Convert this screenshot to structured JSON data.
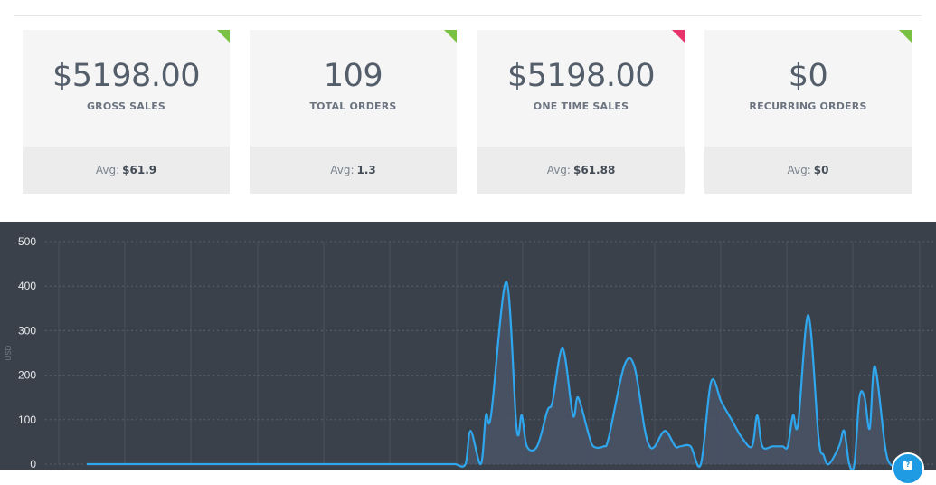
{
  "cards": [
    {
      "value": "$5198.00",
      "label": "GROSS SALES",
      "avg_label": "Avg:",
      "avg_value": "$61.9",
      "corner_color": "#7ac142"
    },
    {
      "value": "109",
      "label": "TOTAL ORDERS",
      "avg_label": "Avg:",
      "avg_value": "1.3",
      "corner_color": "#7ac142"
    },
    {
      "value": "$5198.00",
      "label": "ONE TIME SALES",
      "avg_label": "Avg:",
      "avg_value": "$61.88",
      "corner_color": "#e8336b"
    },
    {
      "value": "$0",
      "label": "RECURRING ORDERS",
      "avg_label": "Avg:",
      "avg_value": "$0",
      "corner_color": "#7ac142"
    }
  ],
  "chart_data": {
    "type": "area",
    "ylabel": "USD",
    "ylim": [
      0,
      500
    ],
    "yticks": [
      "500",
      "400",
      "300",
      "200",
      "100",
      "0"
    ],
    "grid": true,
    "line_color": "#2fa7ee",
    "fill_color": "#4a5566",
    "series": [
      {
        "values": [
          [
            0,
            0
          ],
          [
            1,
            0
          ],
          [
            2,
            0
          ],
          [
            3,
            0
          ],
          [
            4,
            0
          ],
          [
            5,
            0
          ],
          [
            6,
            0
          ],
          [
            7,
            0
          ],
          [
            8,
            0
          ],
          [
            9,
            0
          ],
          [
            10,
            0
          ],
          [
            11,
            0
          ],
          [
            12,
            0
          ],
          [
            13,
            0
          ],
          [
            14,
            0
          ],
          [
            15,
            0
          ],
          [
            16,
            0
          ],
          [
            17,
            0
          ],
          [
            18,
            0
          ],
          [
            19,
            0
          ],
          [
            20,
            0
          ],
          [
            21,
            0
          ],
          [
            22,
            0
          ],
          [
            23,
            0
          ],
          [
            24,
            0
          ],
          [
            25,
            0
          ],
          [
            26,
            0
          ],
          [
            27,
            0
          ],
          [
            28,
            0
          ],
          [
            29,
            0
          ],
          [
            30,
            0
          ],
          [
            31,
            0
          ],
          [
            32,
            0
          ],
          [
            33,
            0
          ],
          [
            34,
            0
          ],
          [
            35,
            0
          ],
          [
            36,
            0
          ],
          [
            37,
            0
          ],
          [
            38,
            0
          ],
          [
            39,
            0
          ],
          [
            40,
            0
          ],
          [
            41,
            0
          ],
          [
            42,
            0
          ],
          [
            43,
            0
          ],
          [
            44,
            0
          ],
          [
            45,
            0
          ],
          [
            46,
            0
          ],
          [
            47,
            0
          ],
          [
            48,
            0
          ],
          [
            49,
            0
          ],
          [
            50,
            0
          ],
          [
            51,
            0
          ],
          [
            52,
            0
          ],
          [
            53,
            0
          ],
          [
            54,
            0
          ],
          [
            55,
            0
          ],
          [
            56,
            0
          ],
          [
            57,
            0
          ],
          [
            58,
            0
          ],
          [
            59,
            0
          ],
          [
            60,
            0
          ],
          [
            61,
            0
          ],
          [
            62,
            0
          ],
          [
            63,
            0
          ],
          [
            64,
            0
          ],
          [
            65,
            0
          ],
          [
            66,
            0
          ],
          [
            67,
            0
          ],
          [
            68,
            0
          ],
          [
            69,
            0
          ],
          [
            70,
            0
          ],
          [
            71,
            0
          ],
          [
            72,
            0
          ],
          [
            74,
            0
          ],
          [
            75,
            75
          ],
          [
            77,
            0
          ],
          [
            78,
            110
          ],
          [
            79,
            110
          ],
          [
            82,
            410
          ],
          [
            84,
            80
          ],
          [
            85,
            110
          ],
          [
            86,
            40
          ],
          [
            88,
            40
          ],
          [
            90,
            120
          ],
          [
            91,
            140
          ],
          [
            93,
            260
          ],
          [
            95,
            110
          ],
          [
            96,
            150
          ],
          [
            98,
            70
          ],
          [
            99,
            40
          ],
          [
            101,
            40
          ],
          [
            102,
            60
          ],
          [
            105,
            220
          ],
          [
            107,
            220
          ],
          [
            109,
            80
          ],
          [
            110,
            40
          ],
          [
            111,
            40
          ],
          [
            113,
            75
          ],
          [
            115,
            40
          ],
          [
            116,
            40
          ],
          [
            118,
            40
          ],
          [
            120,
            0
          ],
          [
            122,
            185
          ],
          [
            124,
            140
          ],
          [
            126,
            100
          ],
          [
            128,
            60
          ],
          [
            130,
            40
          ],
          [
            131,
            110
          ],
          [
            132,
            40
          ],
          [
            134,
            40
          ],
          [
            135,
            40
          ],
          [
            136,
            40
          ],
          [
            137,
            40
          ],
          [
            138,
            110
          ],
          [
            139,
            90
          ],
          [
            141,
            335
          ],
          [
            143,
            60
          ],
          [
            144,
            20
          ],
          [
            145,
            0
          ],
          [
            147,
            40
          ],
          [
            148,
            75
          ],
          [
            149,
            0
          ],
          [
            150,
            0
          ],
          [
            151,
            150
          ],
          [
            152,
            150
          ],
          [
            153,
            80
          ],
          [
            154,
            220
          ],
          [
            156,
            40
          ],
          [
            157,
            0
          ],
          [
            158,
            0
          ]
        ]
      }
    ]
  }
}
